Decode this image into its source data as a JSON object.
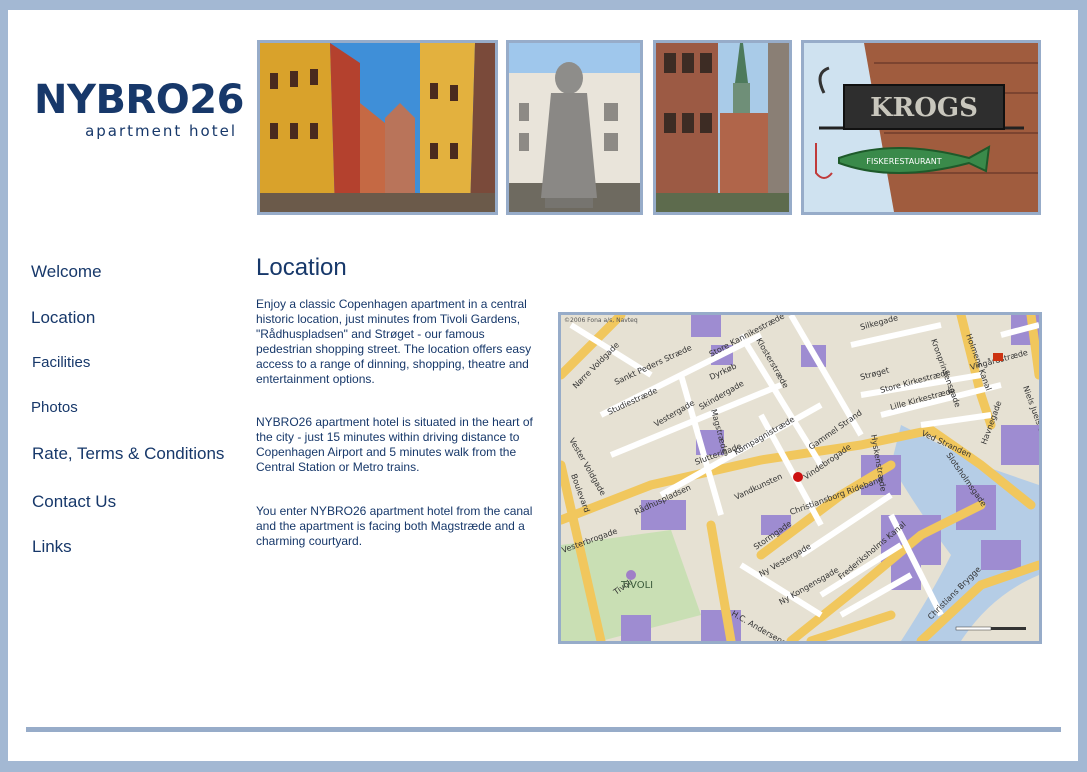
{
  "logo": {
    "name": "NYBRO26",
    "tagline": "apartment hotel"
  },
  "nav": [
    {
      "label": "Welcome"
    },
    {
      "label": "Location"
    },
    {
      "label": "Facilities"
    },
    {
      "label": "Photos"
    },
    {
      "label": "Rate, Terms & Conditions"
    },
    {
      "label": "Contact Us"
    },
    {
      "label": "Links"
    }
  ],
  "content": {
    "title": "Location",
    "para1": "Enjoy a classic Copenhagen apartment in a central historic location, just minutes from Tivoli Gardens, \"Rådhuspladsen\"  and Strøget - our famous pedestrian shopping street. The location offers easy access to a range of dinning, shopping, theatre and entertainment options.",
    "para2": "NYBRO26 apartment hotel is situated in the heart of the city - just 15 minutes within driving distance to Copenhagen Airport and 5 minutes walk from the Central Station or Metro trains.",
    "para3": "You enter NYBRO26 apartment hotel from the canal and the apartment is facing both Magstræde and a charming courtyard."
  },
  "photos": {
    "krogs_sign": "KROGS",
    "krogs_fish": "FISKERESTAURANT"
  },
  "map": {
    "copyright": "©2006 Fona a/s, Navteq",
    "streets": [
      "Nørre Voldgade",
      "Sankt Peders Stræde",
      "Studiestræde",
      "Store Kannikestræde",
      "Dyrkøb",
      "Skindergade",
      "Vestergade",
      "Klosterstræde",
      "Strøget",
      "Kompagnistræde",
      "Gammel Strand",
      "Vindebrogade",
      "Slotsholmsgade",
      "Rådhuspladsen",
      "Vester Voldgade",
      "Vesterbrogade",
      "Stormgade",
      "Ny Vestergade",
      "Christiansborg Ridebane",
      "Frederiksholms Kanal",
      "Ny Kongensgade",
      "H.C. Andersens Boulevard",
      "Christians Brygge",
      "Holmens Kanal",
      "Store Kirkestræde",
      "Lille Kirkestræde",
      "Vingårdstræde",
      "Ved Stranden",
      "Havnegade",
      "Niels Juels Gade",
      "Vandkunsten",
      "Slutterigade",
      "Silkegade",
      "Kronprinsensgade",
      "Boulevard",
      "Tivoli",
      "Magstræde",
      "Hyskenstræde"
    ],
    "tivoli": "TIVOLI"
  },
  "colors": {
    "brand": "#17386a",
    "frame": "#97acc9",
    "background": "#a3b8d3"
  }
}
